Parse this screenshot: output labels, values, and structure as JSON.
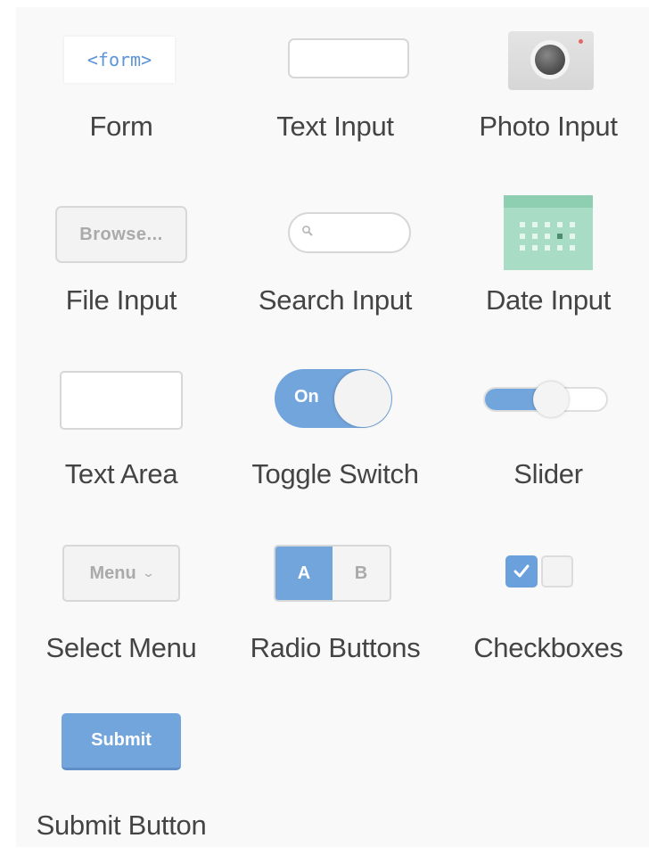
{
  "tiles": {
    "form": {
      "label": "Form",
      "preview_text": "<form>"
    },
    "text_input": {
      "label": "Text Input"
    },
    "photo_input": {
      "label": "Photo Input",
      "icon": "camera-icon"
    },
    "file_input": {
      "label": "File Input",
      "button_text": "Browse..."
    },
    "search_input": {
      "label": "Search Input",
      "icon": "magnifier-icon"
    },
    "date_input": {
      "label": "Date Input",
      "icon": "calendar-icon"
    },
    "text_area": {
      "label": "Text Area"
    },
    "toggle_switch": {
      "label": "Toggle Switch",
      "state_text": "On"
    },
    "slider": {
      "label": "Slider",
      "value_fraction": 0.5
    },
    "select_menu": {
      "label": "Select Menu",
      "selected_text": "Menu",
      "icon": "chevron-down-icon"
    },
    "radio_buttons": {
      "label": "Radio Buttons",
      "options": [
        "A",
        "B"
      ],
      "selected": "A"
    },
    "checkboxes": {
      "label": "Checkboxes",
      "states": [
        true,
        false
      ],
      "icon": "check-icon"
    },
    "submit_button": {
      "label": "Submit Button",
      "button_text": "Submit"
    }
  },
  "colors": {
    "accent": "#73a5dd",
    "calendar": "#a9dcc4",
    "form_tag": "#5b94d8",
    "label": "#444444"
  }
}
